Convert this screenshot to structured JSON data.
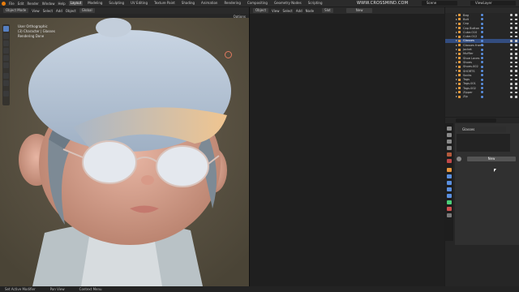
{
  "menu": {
    "items": [
      "File",
      "Edit",
      "Render",
      "Window",
      "Help"
    ]
  },
  "workspaces": [
    "Layout",
    "Modeling",
    "Sculpting",
    "UV Editing",
    "Texture Paint",
    "Shading",
    "Animation",
    "Rendering",
    "Compositing",
    "Geometry Nodes",
    "Scripting"
  ],
  "active_workspace": "Layout",
  "watermark": "WWW.CROSSMIND.COM",
  "scene": {
    "label": "Scene"
  },
  "view_layer": {
    "label": "ViewLayer"
  },
  "viewport_header": {
    "mode": "Object Mode",
    "menus": [
      "View",
      "Select",
      "Add",
      "Object"
    ],
    "orientation": "Global",
    "options": "Options"
  },
  "viewport_overlay": {
    "view_name": "User Orthographic",
    "collection": "(3) Character | Glasses",
    "status": "Rendering Done"
  },
  "editor2_header": {
    "mode": "Object",
    "menus": [
      "View",
      "Select",
      "Add",
      "Node"
    ],
    "slot": "Slot",
    "new_label": "New"
  },
  "outliner": {
    "items": [
      {
        "name": "Bag",
        "selected": false
      },
      {
        "name": "Bolt",
        "selected": false
      },
      {
        "name": "Cap",
        "selected": false
      },
      {
        "name": "Cap Button",
        "selected": false
      },
      {
        "name": "Cube.010",
        "selected": false
      },
      {
        "name": "Cube.012",
        "selected": false
      },
      {
        "name": "Glasses",
        "selected": true
      },
      {
        "name": "Glasses frame",
        "selected": false
      },
      {
        "name": "Jacket",
        "selected": false
      },
      {
        "name": "Muffler",
        "selected": false
      },
      {
        "name": "Shoe Laces",
        "selected": false
      },
      {
        "name": "Shoes",
        "selected": false
      },
      {
        "name": "Shoes.002",
        "selected": false
      },
      {
        "name": "SHORTS",
        "selected": false
      },
      {
        "name": "Socks",
        "selected": false
      },
      {
        "name": "Tags",
        "selected": false
      },
      {
        "name": "Tags.001",
        "selected": false
      },
      {
        "name": "Tags.002",
        "selected": false
      },
      {
        "name": "Zipper",
        "selected": false
      },
      {
        "name": "Zip",
        "selected": false
      }
    ]
  },
  "properties": {
    "object_name": "Glasses",
    "new_button": "New"
  },
  "statusbar": {
    "items": [
      "Set Active Modifier",
      "Pan View",
      "Context Menu"
    ]
  },
  "colors": {
    "accent_blue": "#334d80",
    "orange": "#e87d0d",
    "active_tool": "#5680c2"
  }
}
